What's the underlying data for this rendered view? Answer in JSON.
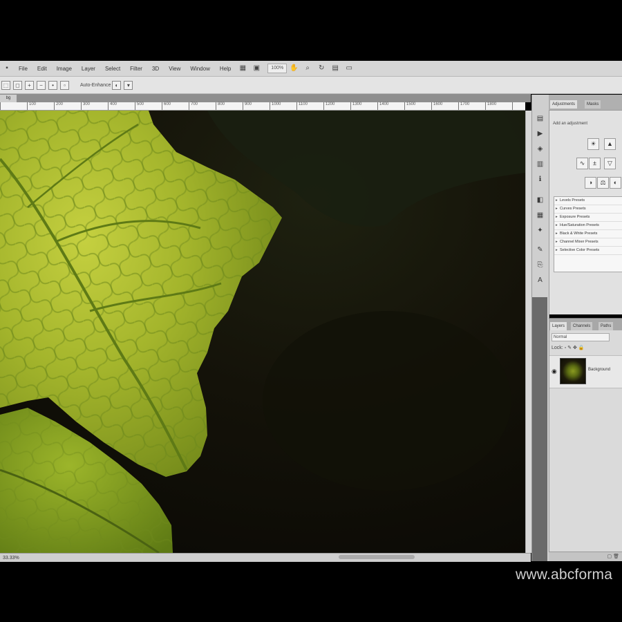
{
  "menubar": {
    "items": [
      "File",
      "Edit",
      "Image",
      "Layer",
      "Select",
      "Filter",
      "3D",
      "View",
      "Window",
      "Help"
    ],
    "zoom": "100%"
  },
  "options": {
    "label": "Auto-Enhance"
  },
  "document": {
    "tab": "bg",
    "ruler_numbers": [
      "100",
      "200",
      "300",
      "400",
      "500",
      "600",
      "700",
      "800",
      "900",
      "1000",
      "1100",
      "1200",
      "1300",
      "1400",
      "1500",
      "1600",
      "1700",
      "1800"
    ]
  },
  "status": {
    "zoom": "33.33%"
  },
  "adjustments": {
    "tabs": [
      "Adjustments",
      "Masks"
    ],
    "header": "Add an adjustment",
    "presets": [
      "Levels Presets",
      "Curves Presets",
      "Exposure Presets",
      "Hue/Saturation Presets",
      "Black & White Presets",
      "Channel Mixer Presets",
      "Selective Color Presets"
    ]
  },
  "layers": {
    "tabs": [
      "Layers",
      "Channels",
      "Paths"
    ],
    "blend_mode": "Normal",
    "lock_label": "Lock:",
    "layer_name": "Background"
  },
  "watermark": "www.abcforma"
}
